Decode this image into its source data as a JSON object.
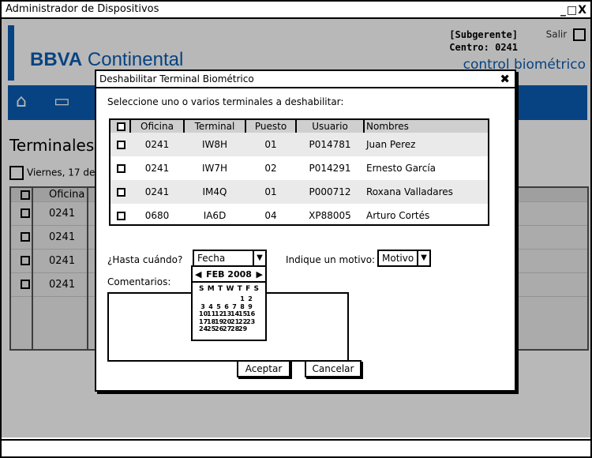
{
  "window": {
    "title": "Administrador de Dispositivos",
    "controls": "_□X"
  },
  "app": {
    "brand_bold": "BBVA",
    "brand_rest": " Continental",
    "user_role": "[Subgerente]",
    "user_center": "Centro: 0241",
    "logout_label": "Salir",
    "sub_brand": "control biométrico",
    "page_title": "Terminales d",
    "date_text": "Viernes, 17 de",
    "bg_table": {
      "header": "Oficina",
      "rows": [
        "0241",
        "0241",
        "0241",
        "0241"
      ]
    }
  },
  "dialog": {
    "title": "Deshabilitar Terminal Biométrico",
    "close": "✖",
    "instruction": "Seleccione uno o varios terminales a deshabilitar:",
    "columns": [
      "Oficina",
      "Terminal",
      "Puesto",
      "Usuario",
      "Nombres"
    ],
    "rows": [
      {
        "oficina": "0241",
        "terminal": "IW8H",
        "puesto": "01",
        "usuario": "P014781",
        "nombres": "Juan Perez"
      },
      {
        "oficina": "0241",
        "terminal": "IW7H",
        "puesto": "02",
        "usuario": "P014291",
        "nombres": "Ernesto García"
      },
      {
        "oficina": "0241",
        "terminal": "IM4Q",
        "puesto": "01",
        "usuario": "P000712",
        "nombres": "Roxana Valladares"
      },
      {
        "oficina": "0680",
        "terminal": "IA6D",
        "puesto": "04",
        "usuario": "XP88005",
        "nombres": "Arturo Cortés"
      }
    ],
    "until_label": "¿Hasta cuándo?",
    "date_select": "Fecha",
    "reason_label": "Indique un motivo:",
    "reason_select": "Motivo",
    "comments_label": "Comentarios:",
    "calendar": {
      "month_label": "FEB 2008",
      "weekdays": [
        "S",
        "M",
        "T",
        "W",
        "T",
        "F",
        "S"
      ],
      "weeks": [
        [
          "",
          "",
          "",
          "",
          "",
          "1",
          "2"
        ],
        [
          "3",
          "4",
          "5",
          "6",
          "7",
          "8",
          "9"
        ],
        [
          "10",
          "11",
          "12",
          "13",
          "14",
          "15",
          "16"
        ],
        [
          "17",
          "18",
          "19",
          "20",
          "21",
          "22",
          "23"
        ],
        [
          "24",
          "25",
          "26",
          "27",
          "28",
          "29",
          ""
        ]
      ]
    },
    "accept_label": "Aceptar",
    "cancel_label": "Cancelar"
  }
}
